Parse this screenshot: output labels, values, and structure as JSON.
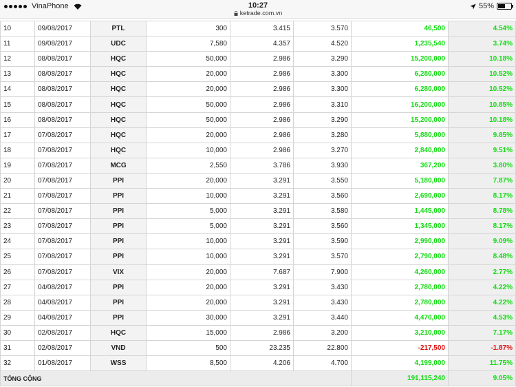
{
  "status": {
    "carrier": "VinaPhone",
    "time": "10:27",
    "url": "ketrade.com.vn",
    "battery": "55%",
    "battery_level": 0.55
  },
  "colors": {
    "positive": "#11dd11",
    "negative": "#dd1111"
  },
  "rows": [
    {
      "no": "10",
      "date": "09/08/2017",
      "symbol": "PTL",
      "qty": "300",
      "buy": "3.415",
      "sell": "3.570",
      "pl": "46,500",
      "pct": "4.54%",
      "dir": "pos"
    },
    {
      "no": "11",
      "date": "09/08/2017",
      "symbol": "UDC",
      "qty": "7,580",
      "buy": "4.357",
      "sell": "4.520",
      "pl": "1,235,540",
      "pct": "3.74%",
      "dir": "pos"
    },
    {
      "no": "12",
      "date": "08/08/2017",
      "symbol": "HQC",
      "qty": "50,000",
      "buy": "2.986",
      "sell": "3.290",
      "pl": "15,200,000",
      "pct": "10.18%",
      "dir": "pos"
    },
    {
      "no": "13",
      "date": "08/08/2017",
      "symbol": "HQC",
      "qty": "20,000",
      "buy": "2.986",
      "sell": "3.300",
      "pl": "6,280,000",
      "pct": "10.52%",
      "dir": "pos"
    },
    {
      "no": "14",
      "date": "08/08/2017",
      "symbol": "HQC",
      "qty": "20,000",
      "buy": "2.986",
      "sell": "3.300",
      "pl": "6,280,000",
      "pct": "10.52%",
      "dir": "pos"
    },
    {
      "no": "15",
      "date": "08/08/2017",
      "symbol": "HQC",
      "qty": "50,000",
      "buy": "2.986",
      "sell": "3.310",
      "pl": "16,200,000",
      "pct": "10.85%",
      "dir": "pos"
    },
    {
      "no": "16",
      "date": "08/08/2017",
      "symbol": "HQC",
      "qty": "50,000",
      "buy": "2.986",
      "sell": "3.290",
      "pl": "15,200,000",
      "pct": "10.18%",
      "dir": "pos"
    },
    {
      "no": "17",
      "date": "07/08/2017",
      "symbol": "HQC",
      "qty": "20,000",
      "buy": "2.986",
      "sell": "3.280",
      "pl": "5,880,000",
      "pct": "9.85%",
      "dir": "pos"
    },
    {
      "no": "18",
      "date": "07/08/2017",
      "symbol": "HQC",
      "qty": "10,000",
      "buy": "2.986",
      "sell": "3.270",
      "pl": "2,840,000",
      "pct": "9.51%",
      "dir": "pos"
    },
    {
      "no": "19",
      "date": "07/08/2017",
      "symbol": "MCG",
      "qty": "2,550",
      "buy": "3.786",
      "sell": "3.930",
      "pl": "367,200",
      "pct": "3.80%",
      "dir": "pos"
    },
    {
      "no": "20",
      "date": "07/08/2017",
      "symbol": "PPI",
      "qty": "20,000",
      "buy": "3.291",
      "sell": "3.550",
      "pl": "5,180,000",
      "pct": "7.87%",
      "dir": "pos"
    },
    {
      "no": "21",
      "date": "07/08/2017",
      "symbol": "PPI",
      "qty": "10,000",
      "buy": "3.291",
      "sell": "3.560",
      "pl": "2,690,000",
      "pct": "8.17%",
      "dir": "pos"
    },
    {
      "no": "22",
      "date": "07/08/2017",
      "symbol": "PPI",
      "qty": "5,000",
      "buy": "3.291",
      "sell": "3.580",
      "pl": "1,445,000",
      "pct": "8.78%",
      "dir": "pos"
    },
    {
      "no": "23",
      "date": "07/08/2017",
      "symbol": "PPI",
      "qty": "5,000",
      "buy": "3.291",
      "sell": "3.560",
      "pl": "1,345,000",
      "pct": "8.17%",
      "dir": "pos"
    },
    {
      "no": "24",
      "date": "07/08/2017",
      "symbol": "PPI",
      "qty": "10,000",
      "buy": "3.291",
      "sell": "3.590",
      "pl": "2,990,000",
      "pct": "9.09%",
      "dir": "pos"
    },
    {
      "no": "25",
      "date": "07/08/2017",
      "symbol": "PPI",
      "qty": "10,000",
      "buy": "3.291",
      "sell": "3.570",
      "pl": "2,790,000",
      "pct": "8.48%",
      "dir": "pos"
    },
    {
      "no": "26",
      "date": "07/08/2017",
      "symbol": "VIX",
      "qty": "20,000",
      "buy": "7.687",
      "sell": "7.900",
      "pl": "4,260,000",
      "pct": "2.77%",
      "dir": "pos"
    },
    {
      "no": "27",
      "date": "04/08/2017",
      "symbol": "PPI",
      "qty": "20,000",
      "buy": "3.291",
      "sell": "3.430",
      "pl": "2,780,000",
      "pct": "4.22%",
      "dir": "pos"
    },
    {
      "no": "28",
      "date": "04/08/2017",
      "symbol": "PPI",
      "qty": "20,000",
      "buy": "3.291",
      "sell": "3.430",
      "pl": "2,780,000",
      "pct": "4.22%",
      "dir": "pos"
    },
    {
      "no": "29",
      "date": "04/08/2017",
      "symbol": "PPI",
      "qty": "30,000",
      "buy": "3.291",
      "sell": "3.440",
      "pl": "4,470,000",
      "pct": "4.53%",
      "dir": "pos"
    },
    {
      "no": "30",
      "date": "02/08/2017",
      "symbol": "HQC",
      "qty": "15,000",
      "buy": "2.986",
      "sell": "3.200",
      "pl": "3,210,000",
      "pct": "7.17%",
      "dir": "pos"
    },
    {
      "no": "31",
      "date": "02/08/2017",
      "symbol": "VND",
      "qty": "500",
      "buy": "23.235",
      "sell": "22.800",
      "pl": "-217,500",
      "pct": "-1.87%",
      "dir": "neg"
    },
    {
      "no": "32",
      "date": "01/08/2017",
      "symbol": "WSS",
      "qty": "8,500",
      "buy": "4.206",
      "sell": "4.700",
      "pl": "4,199,000",
      "pct": "11.75%",
      "dir": "pos"
    }
  ],
  "total": {
    "label": "TỔNG CỘNG",
    "pl": "191,115,240",
    "pct": "9.05%"
  }
}
